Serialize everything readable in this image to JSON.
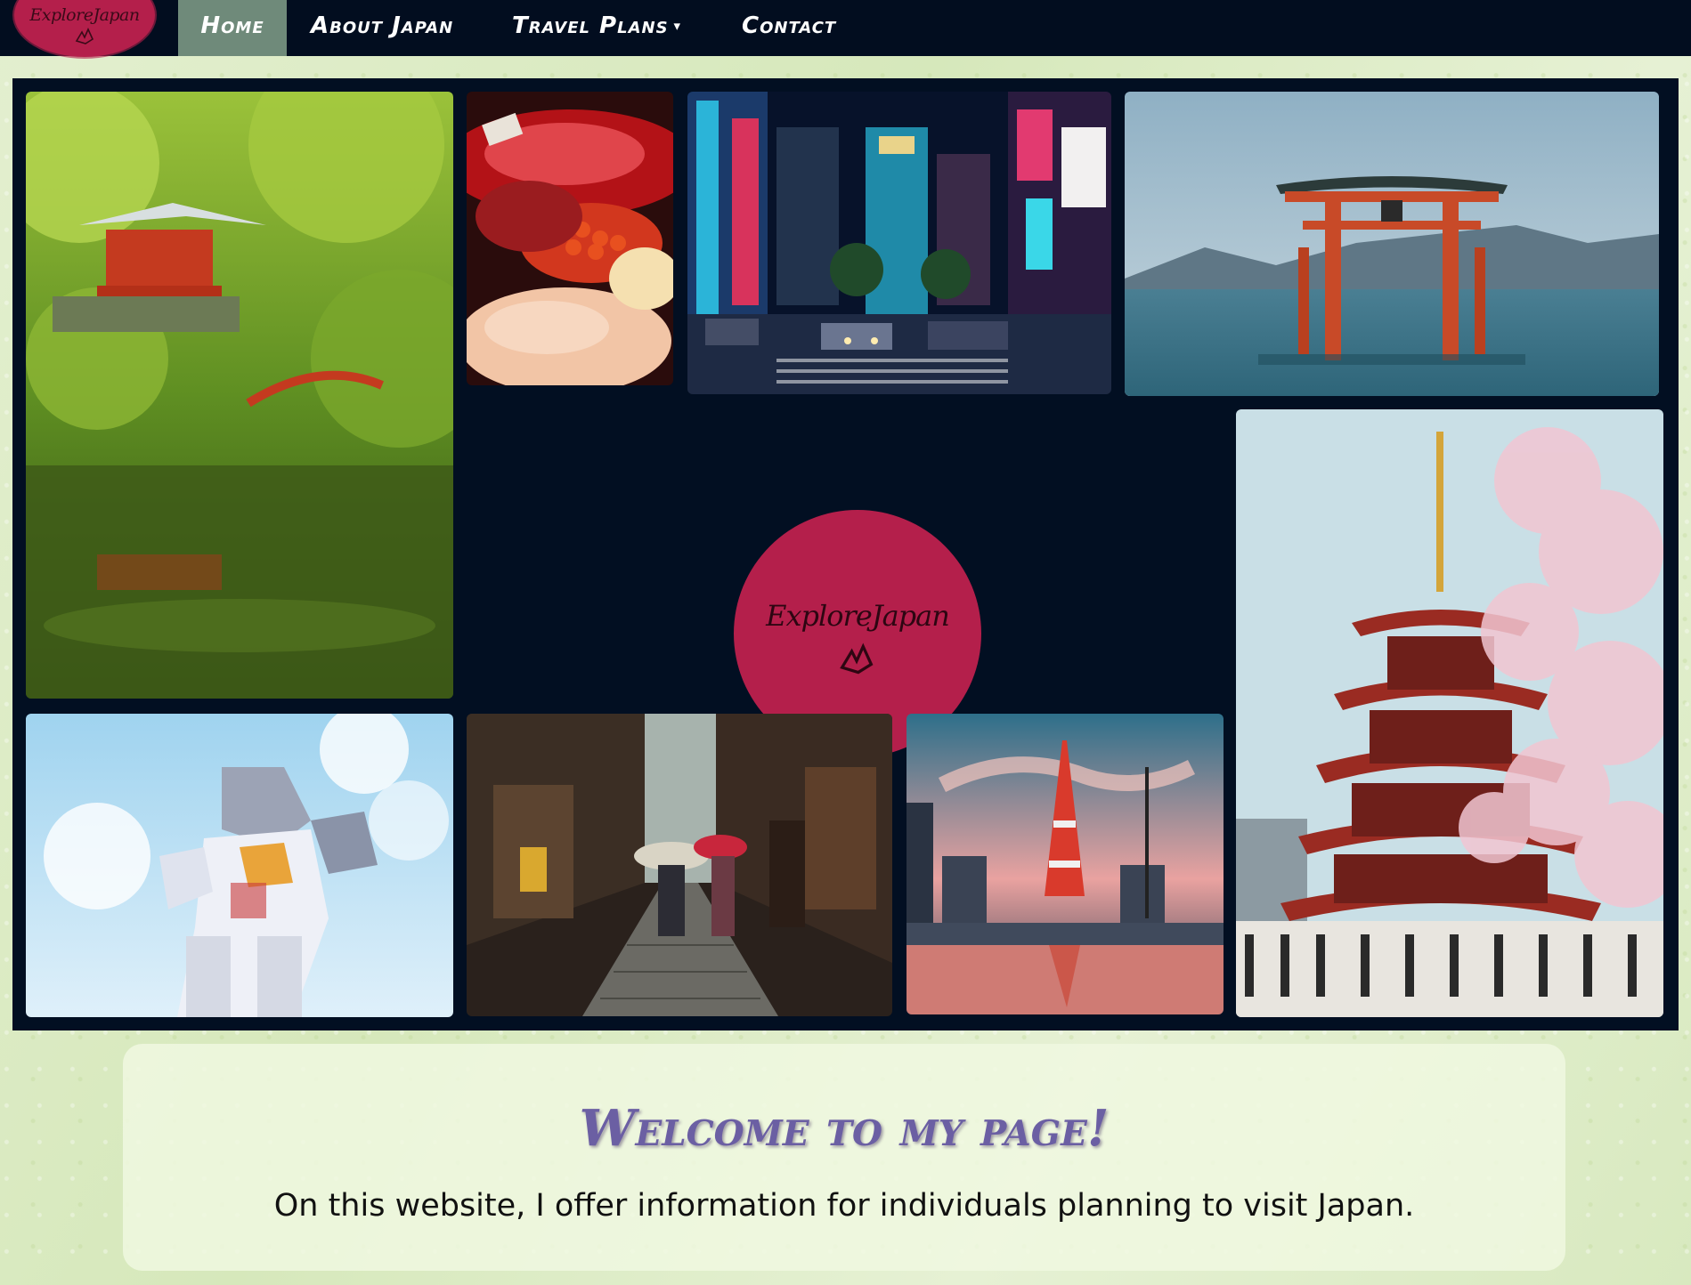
{
  "nav": {
    "logo_text": "ExploreJapan",
    "logo_glyph": "𐂂",
    "items": [
      {
        "label": "Home",
        "active": true
      },
      {
        "label": "About Japan"
      },
      {
        "label": "Travel Plans",
        "caret": "▾"
      },
      {
        "label": "Contact"
      }
    ]
  },
  "gallery": {
    "center_logo_text": "ExploreJapan",
    "center_logo_glyph": "𐂂",
    "photos": [
      {
        "subject": "temple-garden-pond"
      },
      {
        "subject": "sushi-platter"
      },
      {
        "subject": "tokyo-night-crossing"
      },
      {
        "subject": "torii-gate-in-sea"
      },
      {
        "subject": "pagoda-cherry-blossom"
      },
      {
        "subject": "gundam-statue"
      },
      {
        "subject": "kyoto-alley-umbrellas"
      },
      {
        "subject": "tokyo-tower-sunset"
      }
    ]
  },
  "welcome": {
    "title": "Welcome to my page!",
    "text": "On this website, I offer information for individuals planning to visit Japan."
  },
  "colors": {
    "nav_bg": "#020d1f",
    "gallery_bg": "#020f22",
    "logo_red": "#b41f4b",
    "active_tab": "#6f8a7a",
    "title_purple": "#6b5fa3",
    "page_green": "#dcebc4"
  }
}
